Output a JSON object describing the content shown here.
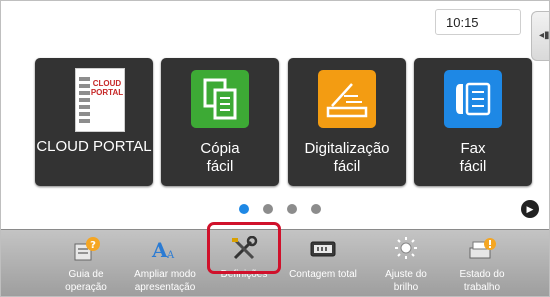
{
  "status": {
    "time": "10:15",
    "side_handle_glyph": "◂▮"
  },
  "tiles": [
    {
      "name": "cloud-portal",
      "label": "CLOUD PORTAL",
      "icon": "cloud-portal-icon",
      "icon_text_line1": "CLOUD",
      "icon_text_line2": "PORTAL"
    },
    {
      "name": "copia-facil",
      "label": "Cópia\nfácil",
      "icon": "copy-icon",
      "color": "#3daa35"
    },
    {
      "name": "digitalizacao-facil",
      "label": "Digitalização\nfácil",
      "icon": "scan-icon",
      "color": "#f39c12"
    },
    {
      "name": "fax-facil",
      "label": "Fax\nfácil",
      "icon": "fax-icon",
      "color": "#1e88e5"
    }
  ],
  "pagination": {
    "total": 4,
    "active_index": 0
  },
  "bottom_bar": [
    {
      "name": "guia-de-operacao",
      "label": "Guia de\noperação",
      "icon": "help-book-icon"
    },
    {
      "name": "ampliar-modo-apresentacao",
      "label": "Ampliar modo\napresentação",
      "icon": "text-size-icon"
    },
    {
      "name": "definicoes",
      "label": "Definições",
      "icon": "settings-tools-icon",
      "highlighted": true
    },
    {
      "name": "contagem-total",
      "label": "Contagem total",
      "icon": "counter-icon"
    },
    {
      "name": "ajuste-do-brilho",
      "label": "Ajuste do\nbrilho",
      "icon": "brightness-icon"
    },
    {
      "name": "estado-do-trabalho",
      "label": "Estado do\ntrabalho",
      "icon": "job-status-icon"
    }
  ],
  "colors": {
    "tile_bg": "#333333",
    "active_dot": "#1e88e5",
    "highlight": "#d0112b"
  }
}
